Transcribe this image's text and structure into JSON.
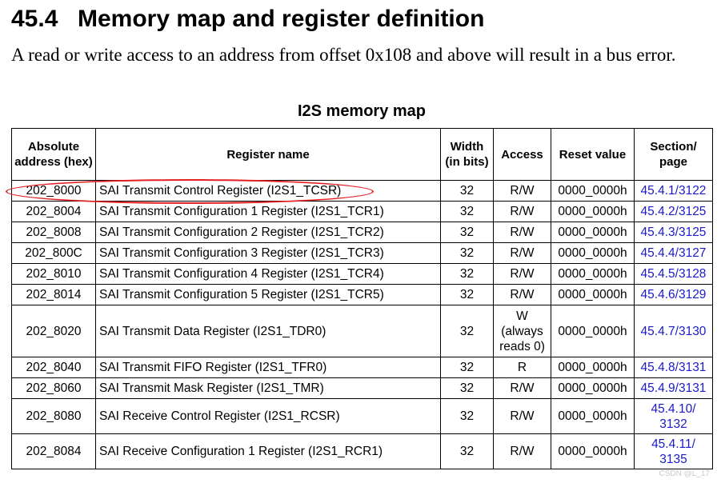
{
  "heading": {
    "number": "45.4",
    "title": "Memory map and register definition"
  },
  "intro": "A read or write access to an address from offset 0x108 and above will result in a bus error.",
  "caption": "I2S memory map",
  "table": {
    "headers": {
      "address": "Absolute address (hex)",
      "name": "Register name",
      "width": "Width (in bits)",
      "access": "Access",
      "reset": "Reset value",
      "section": "Section/ page"
    },
    "rows": [
      {
        "address": "202_8000",
        "name": "SAI Transmit Control Register (I2S1_TCSR)",
        "width": "32",
        "access": "R/W",
        "reset": "0000_0000h",
        "section": "45.4.1/3122"
      },
      {
        "address": "202_8004",
        "name": "SAI Transmit Configuration 1 Register (I2S1_TCR1)",
        "width": "32",
        "access": "R/W",
        "reset": "0000_0000h",
        "section": "45.4.2/3125"
      },
      {
        "address": "202_8008",
        "name": "SAI Transmit Configuration 2 Register (I2S1_TCR2)",
        "width": "32",
        "access": "R/W",
        "reset": "0000_0000h",
        "section": "45.4.3/3125"
      },
      {
        "address": "202_800C",
        "name": "SAI Transmit Configuration 3 Register (I2S1_TCR3)",
        "width": "32",
        "access": "R/W",
        "reset": "0000_0000h",
        "section": "45.4.4/3127"
      },
      {
        "address": "202_8010",
        "name": "SAI Transmit Configuration 4 Register (I2S1_TCR4)",
        "width": "32",
        "access": "R/W",
        "reset": "0000_0000h",
        "section": "45.4.5/3128"
      },
      {
        "address": "202_8014",
        "name": "SAI Transmit Configuration 5 Register (I2S1_TCR5)",
        "width": "32",
        "access": "R/W",
        "reset": "0000_0000h",
        "section": "45.4.6/3129"
      },
      {
        "address": "202_8020",
        "name": "SAI Transmit Data Register (I2S1_TDR0)",
        "width": "32",
        "access": "W (always reads 0)",
        "reset": "0000_0000h",
        "section": "45.4.7/3130"
      },
      {
        "address": "202_8040",
        "name": "SAI Transmit FIFO Register (I2S1_TFR0)",
        "width": "32",
        "access": "R",
        "reset": "0000_0000h",
        "section": "45.4.8/3131"
      },
      {
        "address": "202_8060",
        "name": "SAI Transmit Mask Register (I2S1_TMR)",
        "width": "32",
        "access": "R/W",
        "reset": "0000_0000h",
        "section": "45.4.9/3131"
      },
      {
        "address": "202_8080",
        "name": "SAI Receive Control Register (I2S1_RCSR)",
        "width": "32",
        "access": "R/W",
        "reset": "0000_0000h",
        "section": "45.4.10/ 3132"
      },
      {
        "address": "202_8084",
        "name": "SAI Receive Configuration 1 Register (I2S1_RCR1)",
        "width": "32",
        "access": "R/W",
        "reset": "0000_0000h",
        "section": "45.4.11/ 3135"
      }
    ]
  },
  "highlight_color": "#e32020",
  "watermark": "CSDN @L_17"
}
